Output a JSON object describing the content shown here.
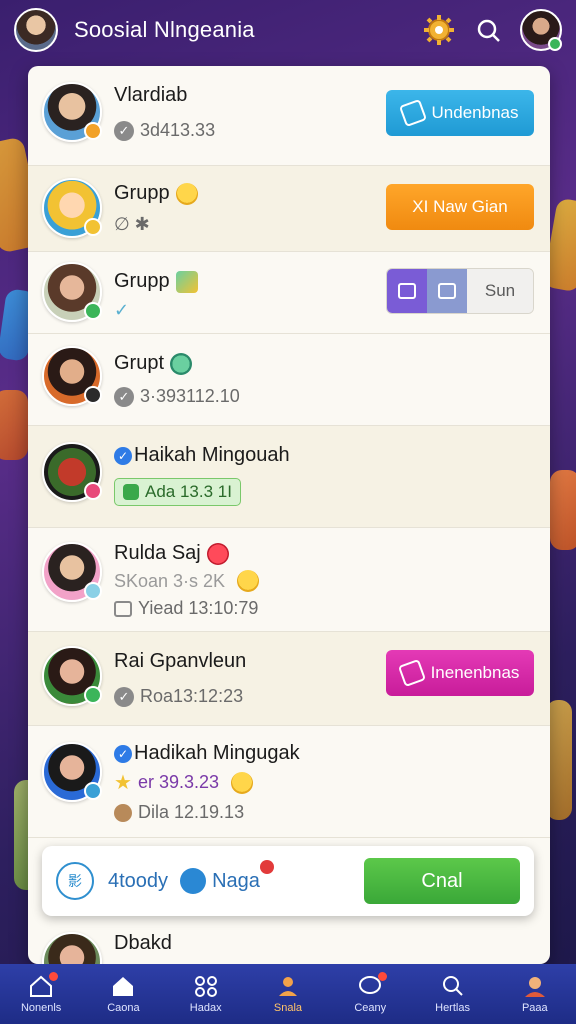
{
  "header": {
    "app_title": "Soosial Nlngeania"
  },
  "rows": [
    {
      "name": "Vlardiab",
      "sub": "3d413.33",
      "button": "Undenbnas"
    },
    {
      "name": "Grupp",
      "sub": "∅ ✱",
      "button": "XI Naw Gian"
    },
    {
      "name": "Grupp",
      "sub": "✓",
      "button": "Sun"
    },
    {
      "name": "Grupt",
      "sub": "3·393112.10"
    },
    {
      "name": "Haikah Mingouah",
      "tag": "Ada 13.3 1I"
    },
    {
      "name": "Rulda Saj",
      "sub": "SKoan 3·s 2K",
      "time": "Yiead 13:10:79"
    },
    {
      "name": "Rai Gpanvleun",
      "sub": "Roa13:12:23",
      "button": "Inenenbnas"
    },
    {
      "name": "Hadikah Mingugak",
      "sub": "er 39.3.23",
      "time": "Dila 12.19.13"
    },
    {
      "name": "Dbakd"
    }
  ],
  "actionbar": {
    "logo": "影",
    "text": "4toody",
    "nag": "Naga",
    "cta": "Cnal"
  },
  "nav": [
    {
      "label": "Nonenls"
    },
    {
      "label": "Caona"
    },
    {
      "label": "Hadax"
    },
    {
      "label": "Snala"
    },
    {
      "label": "Ceany"
    },
    {
      "label": "Hertlas"
    },
    {
      "label": "Paaa"
    }
  ]
}
